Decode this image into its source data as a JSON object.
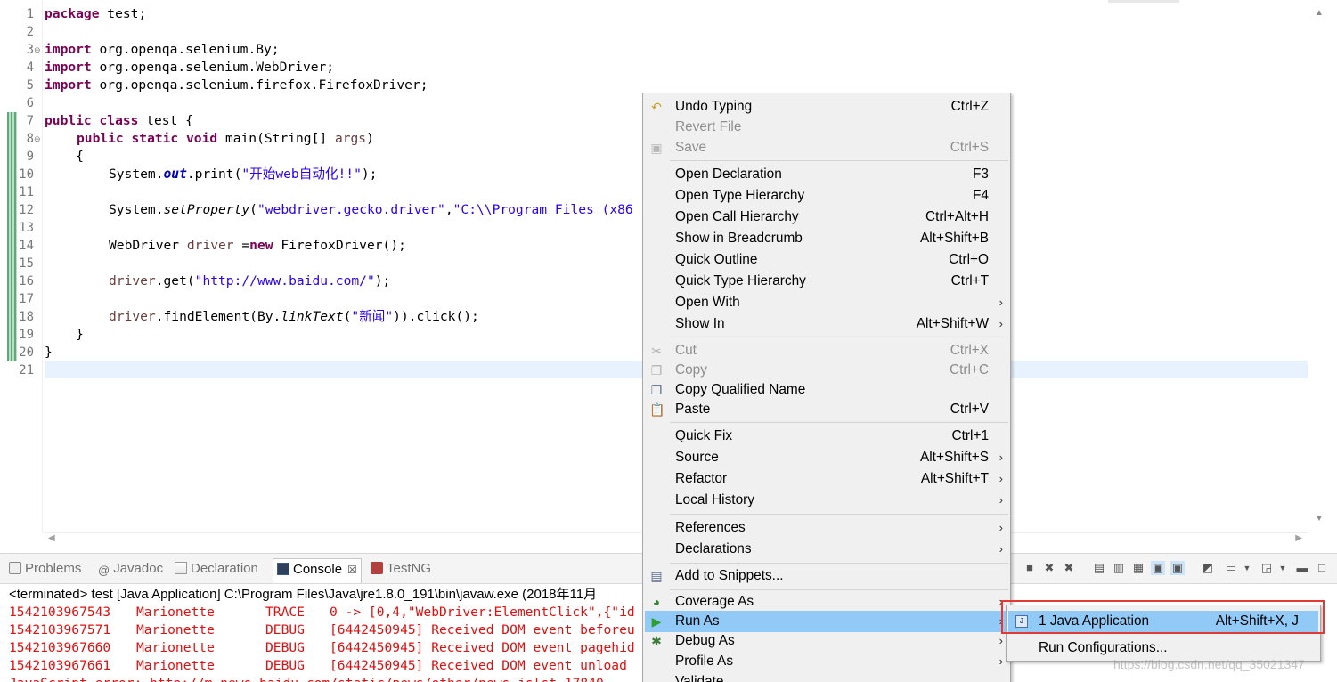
{
  "editor": {
    "line_numbers": [
      "1",
      "2",
      "3",
      "4",
      "5",
      "6",
      "7",
      "8",
      "9",
      "10",
      "11",
      "12",
      "13",
      "14",
      "15",
      "16",
      "17",
      "18",
      "19",
      "20",
      "21"
    ],
    "code": {
      "l1_kw": "package",
      "l1_rest": " test;",
      "l3_kw": "import",
      "l3_rest": " org.openqa.selenium.By;",
      "l4_kw": "import",
      "l4_rest": " org.openqa.selenium.WebDriver;",
      "l5_kw": "import",
      "l5_rest": " org.openqa.selenium.firefox.FirefoxDriver;",
      "l7_kw": "public class",
      "l7_rest": " test {",
      "l8_kw": "public static void",
      "l8_rest": " main(String[] ",
      "l8_var": "args",
      "l8_end": ")",
      "l9": "    {",
      "l10_a": "System.",
      "l10_fld": "out",
      "l10_b": ".print(",
      "l10_str": "\"开始web自动化!!\"",
      "l10_c": ");",
      "l12_a": "System.",
      "l12_itl": "setProperty",
      "l12_b": "(",
      "l12_str1": "\"webdriver.gecko.driver\"",
      "l12_c": ",",
      "l12_str2": "\"C:\\\\Program Files (x86",
      "l14_a": "WebDriver ",
      "l14_var": "driver",
      "l14_b": " =",
      "l14_kw": "new",
      "l14_c": " FirefoxDriver();",
      "l16_var": "driver",
      "l16_a": ".get(",
      "l16_str": "\"http://www.baidu.com/\"",
      "l16_b": ");",
      "l18_var": "driver",
      "l18_a": ".findElement(By.",
      "l18_itl": "linkText",
      "l18_b": "(",
      "l18_str": "\"新闻\"",
      "l18_c": ")).click();",
      "l19": "    }",
      "l20": "}"
    }
  },
  "panel": {
    "tabs": [
      {
        "label": "Problems"
      },
      {
        "label": "Javadoc"
      },
      {
        "label": "Declaration"
      },
      {
        "label": "Console"
      },
      {
        "label": "TestNG"
      }
    ],
    "close_glyph": "☒",
    "console_header": "<terminated> test [Java Application] C:\\Program Files\\Java\\jre1.8.0_191\\bin\\javaw.exe (2018年11月",
    "log_rows": [
      {
        "time": "1542103967543",
        "src": "Marionette",
        "level": "TRACE",
        "msg": "0 -> [0,4,\"WebDriver:ElementClick\",{\"id"
      },
      {
        "time": "1542103967571",
        "src": "Marionette",
        "level": "DEBUG",
        "msg": "[6442450945] Received DOM event beforeu"
      },
      {
        "time": "1542103967660",
        "src": "Marionette",
        "level": "DEBUG",
        "msg": "[6442450945] Received DOM event pagehid"
      },
      {
        "time": "1542103967661",
        "src": "Marionette",
        "level": "DEBUG",
        "msg": "[6442450945] Received DOM event unload"
      }
    ],
    "log_partial": "JavaScript error: http://m.news.baidu.com/static/news/other/news_jslst 17840"
  },
  "menu": {
    "items": [
      {
        "label": "Undo Typing",
        "shortcut": "Ctrl+Z"
      },
      {
        "label": "Revert File",
        "shortcut": ""
      },
      {
        "label": "Save",
        "shortcut": "Ctrl+S"
      },
      {
        "label": "Open Declaration",
        "shortcut": "F3"
      },
      {
        "label": "Open Type Hierarchy",
        "shortcut": "F4"
      },
      {
        "label": "Open Call Hierarchy",
        "shortcut": "Ctrl+Alt+H"
      },
      {
        "label": "Show in Breadcrumb",
        "shortcut": "Alt+Shift+B"
      },
      {
        "label": "Quick Outline",
        "shortcut": "Ctrl+O"
      },
      {
        "label": "Quick Type Hierarchy",
        "shortcut": "Ctrl+T"
      },
      {
        "label": "Open With",
        "shortcut": ""
      },
      {
        "label": "Show In",
        "shortcut": "Alt+Shift+W"
      },
      {
        "label": "Cut",
        "shortcut": "Ctrl+X"
      },
      {
        "label": "Copy",
        "shortcut": "Ctrl+C"
      },
      {
        "label": "Copy Qualified Name",
        "shortcut": ""
      },
      {
        "label": "Paste",
        "shortcut": "Ctrl+V"
      },
      {
        "label": "Quick Fix",
        "shortcut": "Ctrl+1"
      },
      {
        "label": "Source",
        "shortcut": "Alt+Shift+S"
      },
      {
        "label": "Refactor",
        "shortcut": "Alt+Shift+T"
      },
      {
        "label": "Local History",
        "shortcut": ""
      },
      {
        "label": "References",
        "shortcut": ""
      },
      {
        "label": "Declarations",
        "shortcut": ""
      },
      {
        "label": "Add to Snippets...",
        "shortcut": ""
      },
      {
        "label": "Coverage As",
        "shortcut": ""
      },
      {
        "label": "Run As",
        "shortcut": ""
      },
      {
        "label": "Debug As",
        "shortcut": ""
      },
      {
        "label": "Profile As",
        "shortcut": ""
      },
      {
        "label": "Validate",
        "shortcut": ""
      }
    ],
    "arrow": "›"
  },
  "submenu": {
    "items": [
      {
        "label": "1 Java Application",
        "shortcut": "Alt+Shift+X, J",
        "icon_text": "J"
      },
      {
        "label": "Run Configurations...",
        "shortcut": ""
      }
    ]
  },
  "watermark": "https://blog.csdn.net/qq_35021347",
  "colors": {
    "menu_highlight": "#91c9f7",
    "annotation_box": "#e53935",
    "log_text": "#e01010",
    "keyword": "#7f0055",
    "string": "#2a00ff"
  }
}
